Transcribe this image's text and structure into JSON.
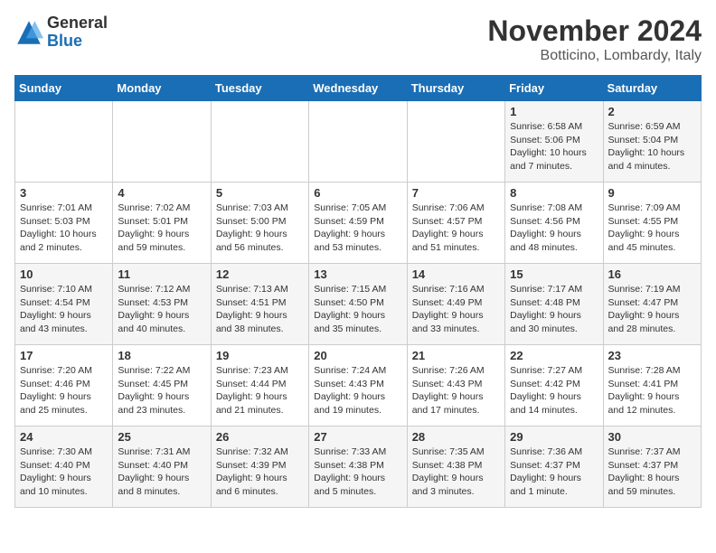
{
  "logo": {
    "general": "General",
    "blue": "Blue"
  },
  "title": "November 2024",
  "location": "Botticino, Lombardy, Italy",
  "days_of_week": [
    "Sunday",
    "Monday",
    "Tuesday",
    "Wednesday",
    "Thursday",
    "Friday",
    "Saturday"
  ],
  "weeks": [
    [
      {
        "day": "",
        "info": ""
      },
      {
        "day": "",
        "info": ""
      },
      {
        "day": "",
        "info": ""
      },
      {
        "day": "",
        "info": ""
      },
      {
        "day": "",
        "info": ""
      },
      {
        "day": "1",
        "info": "Sunrise: 6:58 AM\nSunset: 5:06 PM\nDaylight: 10 hours and 7 minutes."
      },
      {
        "day": "2",
        "info": "Sunrise: 6:59 AM\nSunset: 5:04 PM\nDaylight: 10 hours and 4 minutes."
      }
    ],
    [
      {
        "day": "3",
        "info": "Sunrise: 7:01 AM\nSunset: 5:03 PM\nDaylight: 10 hours and 2 minutes."
      },
      {
        "day": "4",
        "info": "Sunrise: 7:02 AM\nSunset: 5:01 PM\nDaylight: 9 hours and 59 minutes."
      },
      {
        "day": "5",
        "info": "Sunrise: 7:03 AM\nSunset: 5:00 PM\nDaylight: 9 hours and 56 minutes."
      },
      {
        "day": "6",
        "info": "Sunrise: 7:05 AM\nSunset: 4:59 PM\nDaylight: 9 hours and 53 minutes."
      },
      {
        "day": "7",
        "info": "Sunrise: 7:06 AM\nSunset: 4:57 PM\nDaylight: 9 hours and 51 minutes."
      },
      {
        "day": "8",
        "info": "Sunrise: 7:08 AM\nSunset: 4:56 PM\nDaylight: 9 hours and 48 minutes."
      },
      {
        "day": "9",
        "info": "Sunrise: 7:09 AM\nSunset: 4:55 PM\nDaylight: 9 hours and 45 minutes."
      }
    ],
    [
      {
        "day": "10",
        "info": "Sunrise: 7:10 AM\nSunset: 4:54 PM\nDaylight: 9 hours and 43 minutes."
      },
      {
        "day": "11",
        "info": "Sunrise: 7:12 AM\nSunset: 4:53 PM\nDaylight: 9 hours and 40 minutes."
      },
      {
        "day": "12",
        "info": "Sunrise: 7:13 AM\nSunset: 4:51 PM\nDaylight: 9 hours and 38 minutes."
      },
      {
        "day": "13",
        "info": "Sunrise: 7:15 AM\nSunset: 4:50 PM\nDaylight: 9 hours and 35 minutes."
      },
      {
        "day": "14",
        "info": "Sunrise: 7:16 AM\nSunset: 4:49 PM\nDaylight: 9 hours and 33 minutes."
      },
      {
        "day": "15",
        "info": "Sunrise: 7:17 AM\nSunset: 4:48 PM\nDaylight: 9 hours and 30 minutes."
      },
      {
        "day": "16",
        "info": "Sunrise: 7:19 AM\nSunset: 4:47 PM\nDaylight: 9 hours and 28 minutes."
      }
    ],
    [
      {
        "day": "17",
        "info": "Sunrise: 7:20 AM\nSunset: 4:46 PM\nDaylight: 9 hours and 25 minutes."
      },
      {
        "day": "18",
        "info": "Sunrise: 7:22 AM\nSunset: 4:45 PM\nDaylight: 9 hours and 23 minutes."
      },
      {
        "day": "19",
        "info": "Sunrise: 7:23 AM\nSunset: 4:44 PM\nDaylight: 9 hours and 21 minutes."
      },
      {
        "day": "20",
        "info": "Sunrise: 7:24 AM\nSunset: 4:43 PM\nDaylight: 9 hours and 19 minutes."
      },
      {
        "day": "21",
        "info": "Sunrise: 7:26 AM\nSunset: 4:43 PM\nDaylight: 9 hours and 17 minutes."
      },
      {
        "day": "22",
        "info": "Sunrise: 7:27 AM\nSunset: 4:42 PM\nDaylight: 9 hours and 14 minutes."
      },
      {
        "day": "23",
        "info": "Sunrise: 7:28 AM\nSunset: 4:41 PM\nDaylight: 9 hours and 12 minutes."
      }
    ],
    [
      {
        "day": "24",
        "info": "Sunrise: 7:30 AM\nSunset: 4:40 PM\nDaylight: 9 hours and 10 minutes."
      },
      {
        "day": "25",
        "info": "Sunrise: 7:31 AM\nSunset: 4:40 PM\nDaylight: 9 hours and 8 minutes."
      },
      {
        "day": "26",
        "info": "Sunrise: 7:32 AM\nSunset: 4:39 PM\nDaylight: 9 hours and 6 minutes."
      },
      {
        "day": "27",
        "info": "Sunrise: 7:33 AM\nSunset: 4:38 PM\nDaylight: 9 hours and 5 minutes."
      },
      {
        "day": "28",
        "info": "Sunrise: 7:35 AM\nSunset: 4:38 PM\nDaylight: 9 hours and 3 minutes."
      },
      {
        "day": "29",
        "info": "Sunrise: 7:36 AM\nSunset: 4:37 PM\nDaylight: 9 hours and 1 minute."
      },
      {
        "day": "30",
        "info": "Sunrise: 7:37 AM\nSunset: 4:37 PM\nDaylight: 8 hours and 59 minutes."
      }
    ]
  ]
}
